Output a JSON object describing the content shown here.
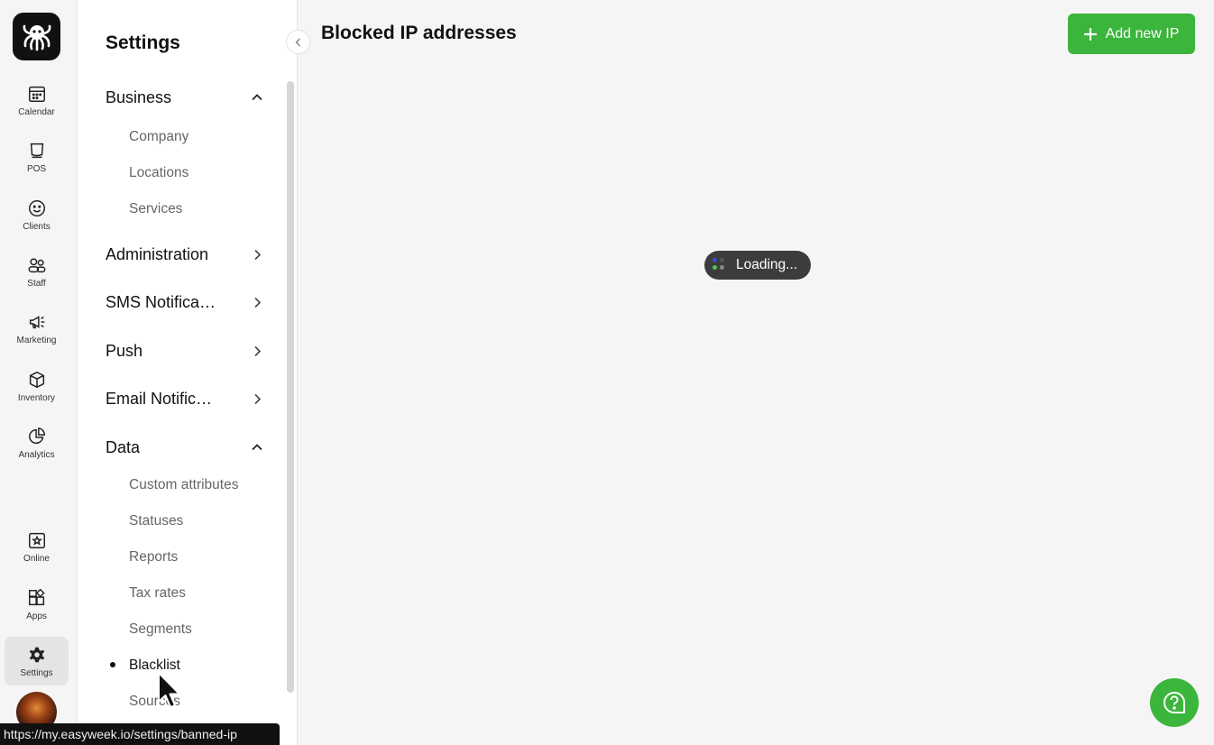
{
  "rail": {
    "items": [
      {
        "id": "calendar",
        "label": "Calendar",
        "icon": "calendar-icon"
      },
      {
        "id": "pos",
        "label": "POS",
        "icon": "pos-icon"
      },
      {
        "id": "clients",
        "label": "Clients",
        "icon": "smiley-icon"
      },
      {
        "id": "staff",
        "label": "Staff",
        "icon": "staff-icon"
      },
      {
        "id": "marketing",
        "label": "Marketing",
        "icon": "megaphone-icon"
      },
      {
        "id": "inventory",
        "label": "Inventory",
        "icon": "box-icon"
      },
      {
        "id": "analytics",
        "label": "Analytics",
        "icon": "pie-chart-icon"
      },
      {
        "id": "online",
        "label": "Online",
        "icon": "star-calendar-icon"
      },
      {
        "id": "apps",
        "label": "Apps",
        "icon": "apps-icon"
      },
      {
        "id": "settings",
        "label": "Settings",
        "icon": "gear-icon",
        "active": true
      }
    ]
  },
  "settings": {
    "title": "Settings",
    "groups": [
      {
        "label": "Business",
        "expanded": true,
        "items": [
          "Company",
          "Locations",
          "Services"
        ]
      },
      {
        "label": "Administration",
        "expanded": false
      },
      {
        "label": "SMS Notifica…",
        "expanded": false
      },
      {
        "label": "Push",
        "expanded": false
      },
      {
        "label": "Email Notific…",
        "expanded": false
      },
      {
        "label": "Data",
        "expanded": true,
        "items": [
          "Custom attributes",
          "Statuses",
          "Reports",
          "Tax rates",
          "Segments",
          "Blacklist",
          "Sources"
        ]
      }
    ],
    "active_item": "Blacklist"
  },
  "main": {
    "title": "Blocked IP addresses",
    "add_button_label": "Add new IP",
    "loading_text": "Loading..."
  },
  "statusbar": {
    "url": "https://my.easyweek.io/settings/banned-ip"
  },
  "colors": {
    "accent_green": "#3bb53b",
    "loading_bg": "#3c3c3c"
  }
}
